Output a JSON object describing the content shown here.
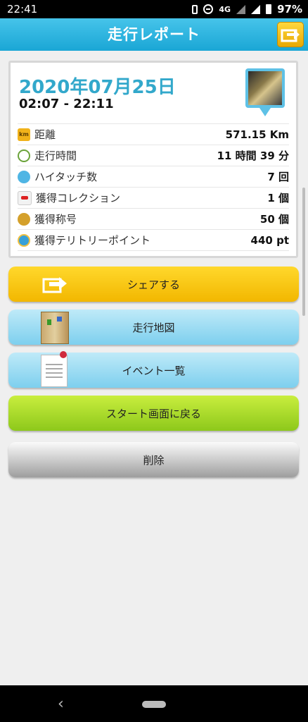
{
  "status": {
    "time": "22:41",
    "network": "4G",
    "battery": "97%"
  },
  "header": {
    "title": "走行レポート",
    "share_icon": "share-icon"
  },
  "report": {
    "date": "2020年07月25日",
    "time_range": "02:07 - 22:11",
    "km_badge": "km",
    "rows": [
      {
        "label": "距離",
        "value": "571.15 Km",
        "icon": "km-icon"
      },
      {
        "label": "走行時間",
        "value": "11 時間 39 分",
        "icon": "clock-icon"
      },
      {
        "label": "ハイタッチ数",
        "value": "7 回",
        "icon": "hand-icon"
      },
      {
        "label": "獲得コレクション",
        "value": "1 個",
        "icon": "car-icon"
      },
      {
        "label": "獲得称号",
        "value": "50 個",
        "icon": "medal-icon"
      },
      {
        "label": "獲得テリトリーポイント",
        "value": "440 pt",
        "icon": "territory-icon"
      }
    ]
  },
  "buttons": {
    "share": "シェアする",
    "map": "走行地図",
    "events": "イベント一覧",
    "start": "スタート画面に戻る",
    "delete": "削除"
  },
  "colors": {
    "header": "#1aa6d5",
    "date": "#32a8cb",
    "share_button": "#f2b700",
    "blue_button": "#7dcfee",
    "green_button": "#8dc81b",
    "gray_button": "#9e9e9e"
  }
}
